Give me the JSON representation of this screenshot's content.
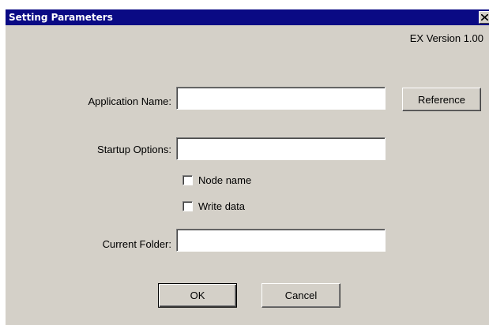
{
  "window": {
    "title": "Setting Parameters",
    "version": "EX Version 1.00"
  },
  "form": {
    "application_name": {
      "label": "Application Name:",
      "value": ""
    },
    "reference_button": "Reference",
    "startup_options": {
      "label": "Startup Options:",
      "value": ""
    },
    "node_name": {
      "label": "Node name",
      "checked": false
    },
    "write_data": {
      "label": "Write data",
      "checked": false
    },
    "current_folder": {
      "label": "Current Folder:",
      "value": ""
    }
  },
  "buttons": {
    "ok": "OK",
    "cancel": "Cancel"
  },
  "colors": {
    "title_bar": "#0a0a84",
    "dialog_bg": "#d4d0c8"
  },
  "icons": {
    "close": "close-icon"
  }
}
